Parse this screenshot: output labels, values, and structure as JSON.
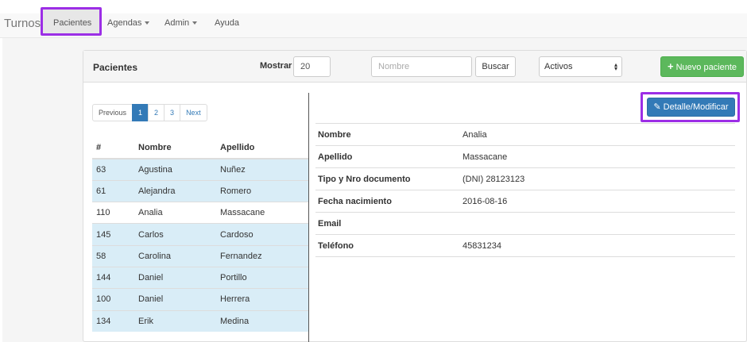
{
  "navbar": {
    "brand": "Turnos",
    "items": [
      {
        "label": "Pacientes",
        "dropdown": false
      },
      {
        "label": "Agendas",
        "dropdown": true
      },
      {
        "label": "Admin",
        "dropdown": true
      },
      {
        "label": "Ayuda",
        "dropdown": false
      }
    ]
  },
  "panel": {
    "title": "Pacientes",
    "mostrar_label": "Mostrar",
    "mostrar_value": "20",
    "search_placeholder": "Nombre",
    "search_button": "Buscar",
    "status_select": "Activos",
    "new_button": "Nuevo paciente"
  },
  "pagination": [
    "Previous",
    "1",
    "2",
    "3",
    "Next"
  ],
  "patients": {
    "headers": [
      "#",
      "Nombre",
      "Apellido"
    ],
    "rows": [
      {
        "id": "63",
        "nombre": "Agustina",
        "apellido": "Nuñez"
      },
      {
        "id": "61",
        "nombre": "Alejandra",
        "apellido": "Romero"
      },
      {
        "id": "110",
        "nombre": "Analia",
        "apellido": "Massacane"
      },
      {
        "id": "145",
        "nombre": "Carlos",
        "apellido": "Cardoso"
      },
      {
        "id": "58",
        "nombre": "Carolina",
        "apellido": "Fernandez"
      },
      {
        "id": "144",
        "nombre": "Daniel",
        "apellido": "Portillo"
      },
      {
        "id": "100",
        "nombre": "Daniel",
        "apellido": "Herrera"
      },
      {
        "id": "134",
        "nombre": "Erik",
        "apellido": "Medina"
      }
    ]
  },
  "details": {
    "edit_button": "Detalle/Modificar",
    "fields": [
      {
        "label": "Nombre",
        "value": "Analia"
      },
      {
        "label": "Apellido",
        "value": "Massacane"
      },
      {
        "label": "Tipo y Nro documento",
        "value": "(DNI) 28123123"
      },
      {
        "label": "Fecha nacimiento",
        "value": "2016-08-16"
      },
      {
        "label": "Email",
        "value": ""
      },
      {
        "label": "Teléfono",
        "value": "45831234"
      }
    ]
  },
  "colors": {
    "highlight": "#9c2ee6",
    "primary": "#337ab7",
    "success": "#5cb85c",
    "selected_row": "#d9edf7"
  }
}
